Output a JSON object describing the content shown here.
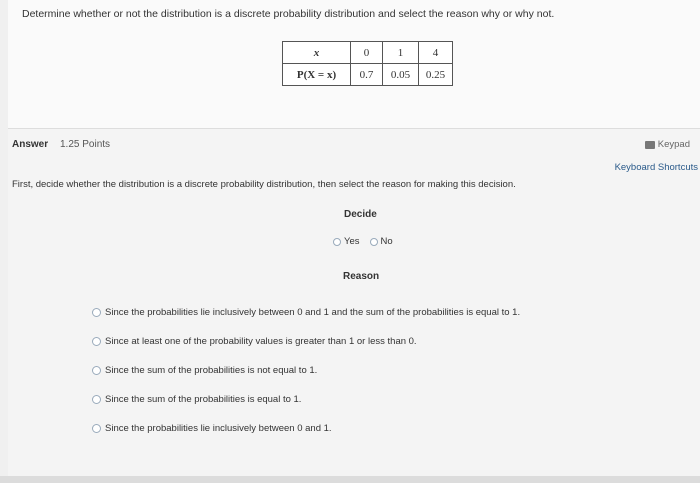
{
  "question": {
    "text": "Determine whether or not the distribution is a discrete probability distribution and select the reason why or why not.",
    "table": {
      "row1_header": "x",
      "row2_header": "P(X = x)",
      "x_values": [
        "0",
        "1",
        "4"
      ],
      "p_values": [
        "0.7",
        "0.05",
        "0.25"
      ]
    }
  },
  "answer": {
    "label": "Answer",
    "points": "1.25 Points",
    "keypad_label": "Keypad",
    "shortcuts_label": "Keyboard Shortcuts",
    "instruction": "First, decide whether the distribution is a discrete probability distribution, then select the reason for making this decision.",
    "decide": {
      "heading": "Decide",
      "options": [
        "Yes",
        "No"
      ]
    },
    "reason": {
      "heading": "Reason",
      "options": [
        "Since the probabilities lie inclusively between 0 and 1 and the sum of the probabilities is equal to 1.",
        "Since at least one of the probability values is greater than 1 or less than 0.",
        "Since the sum of the probabilities is not equal to 1.",
        "Since the sum of the probabilities is equal to 1.",
        "Since the probabilities lie inclusively between 0 and 1."
      ]
    }
  },
  "colors": {
    "link": "#2a5a8a",
    "radio_border": "#99aabb"
  },
  "icons": {
    "keypad": "keypad-icon"
  }
}
